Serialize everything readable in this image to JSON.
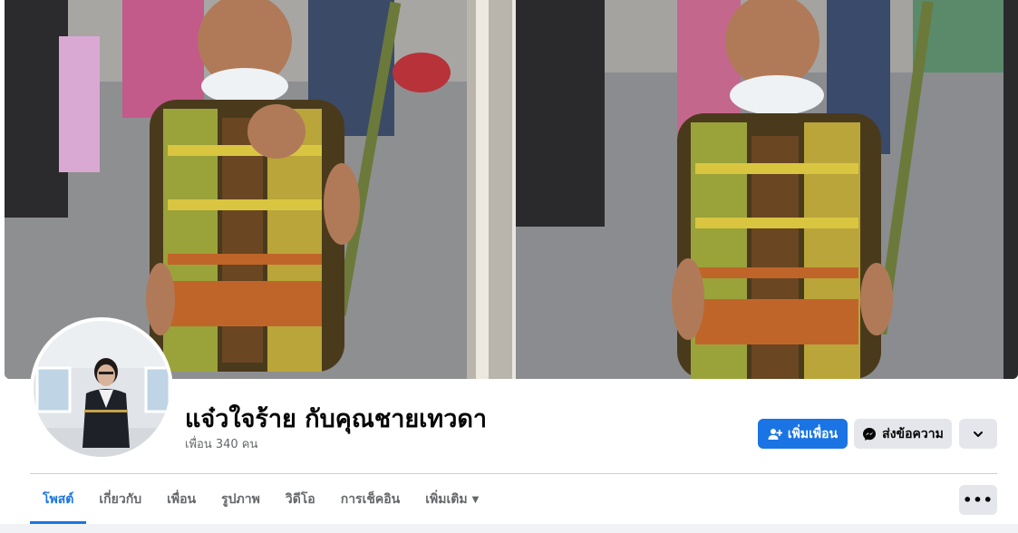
{
  "profile": {
    "name": "แจ๋วใจร้าย กับคุณชายเทวดา",
    "friends_count": "เพื่อน 340 คน"
  },
  "actions": {
    "add_friend": "เพิ่มเพื่อน",
    "message": "ส่งข้อความ"
  },
  "tabs": [
    {
      "label": "โพสต์",
      "active": true
    },
    {
      "label": "เกี่ยวกับ",
      "active": false
    },
    {
      "label": "เพื่อน",
      "active": false
    },
    {
      "label": "รูปภาพ",
      "active": false
    },
    {
      "label": "วิดีโอ",
      "active": false
    },
    {
      "label": "การเช็คอิน",
      "active": false
    },
    {
      "label": "เพิ่มเติม",
      "active": false
    }
  ],
  "icons": {
    "add_friend": "person-plus-icon",
    "message": "messenger-icon",
    "expand": "chevron-down-icon",
    "more_caret": "caret-down-icon",
    "overflow": "ellipsis-icon"
  },
  "colors": {
    "accent": "#1b74e4",
    "secondary_button": "#e4e6eb",
    "muted_text": "#65676b"
  }
}
